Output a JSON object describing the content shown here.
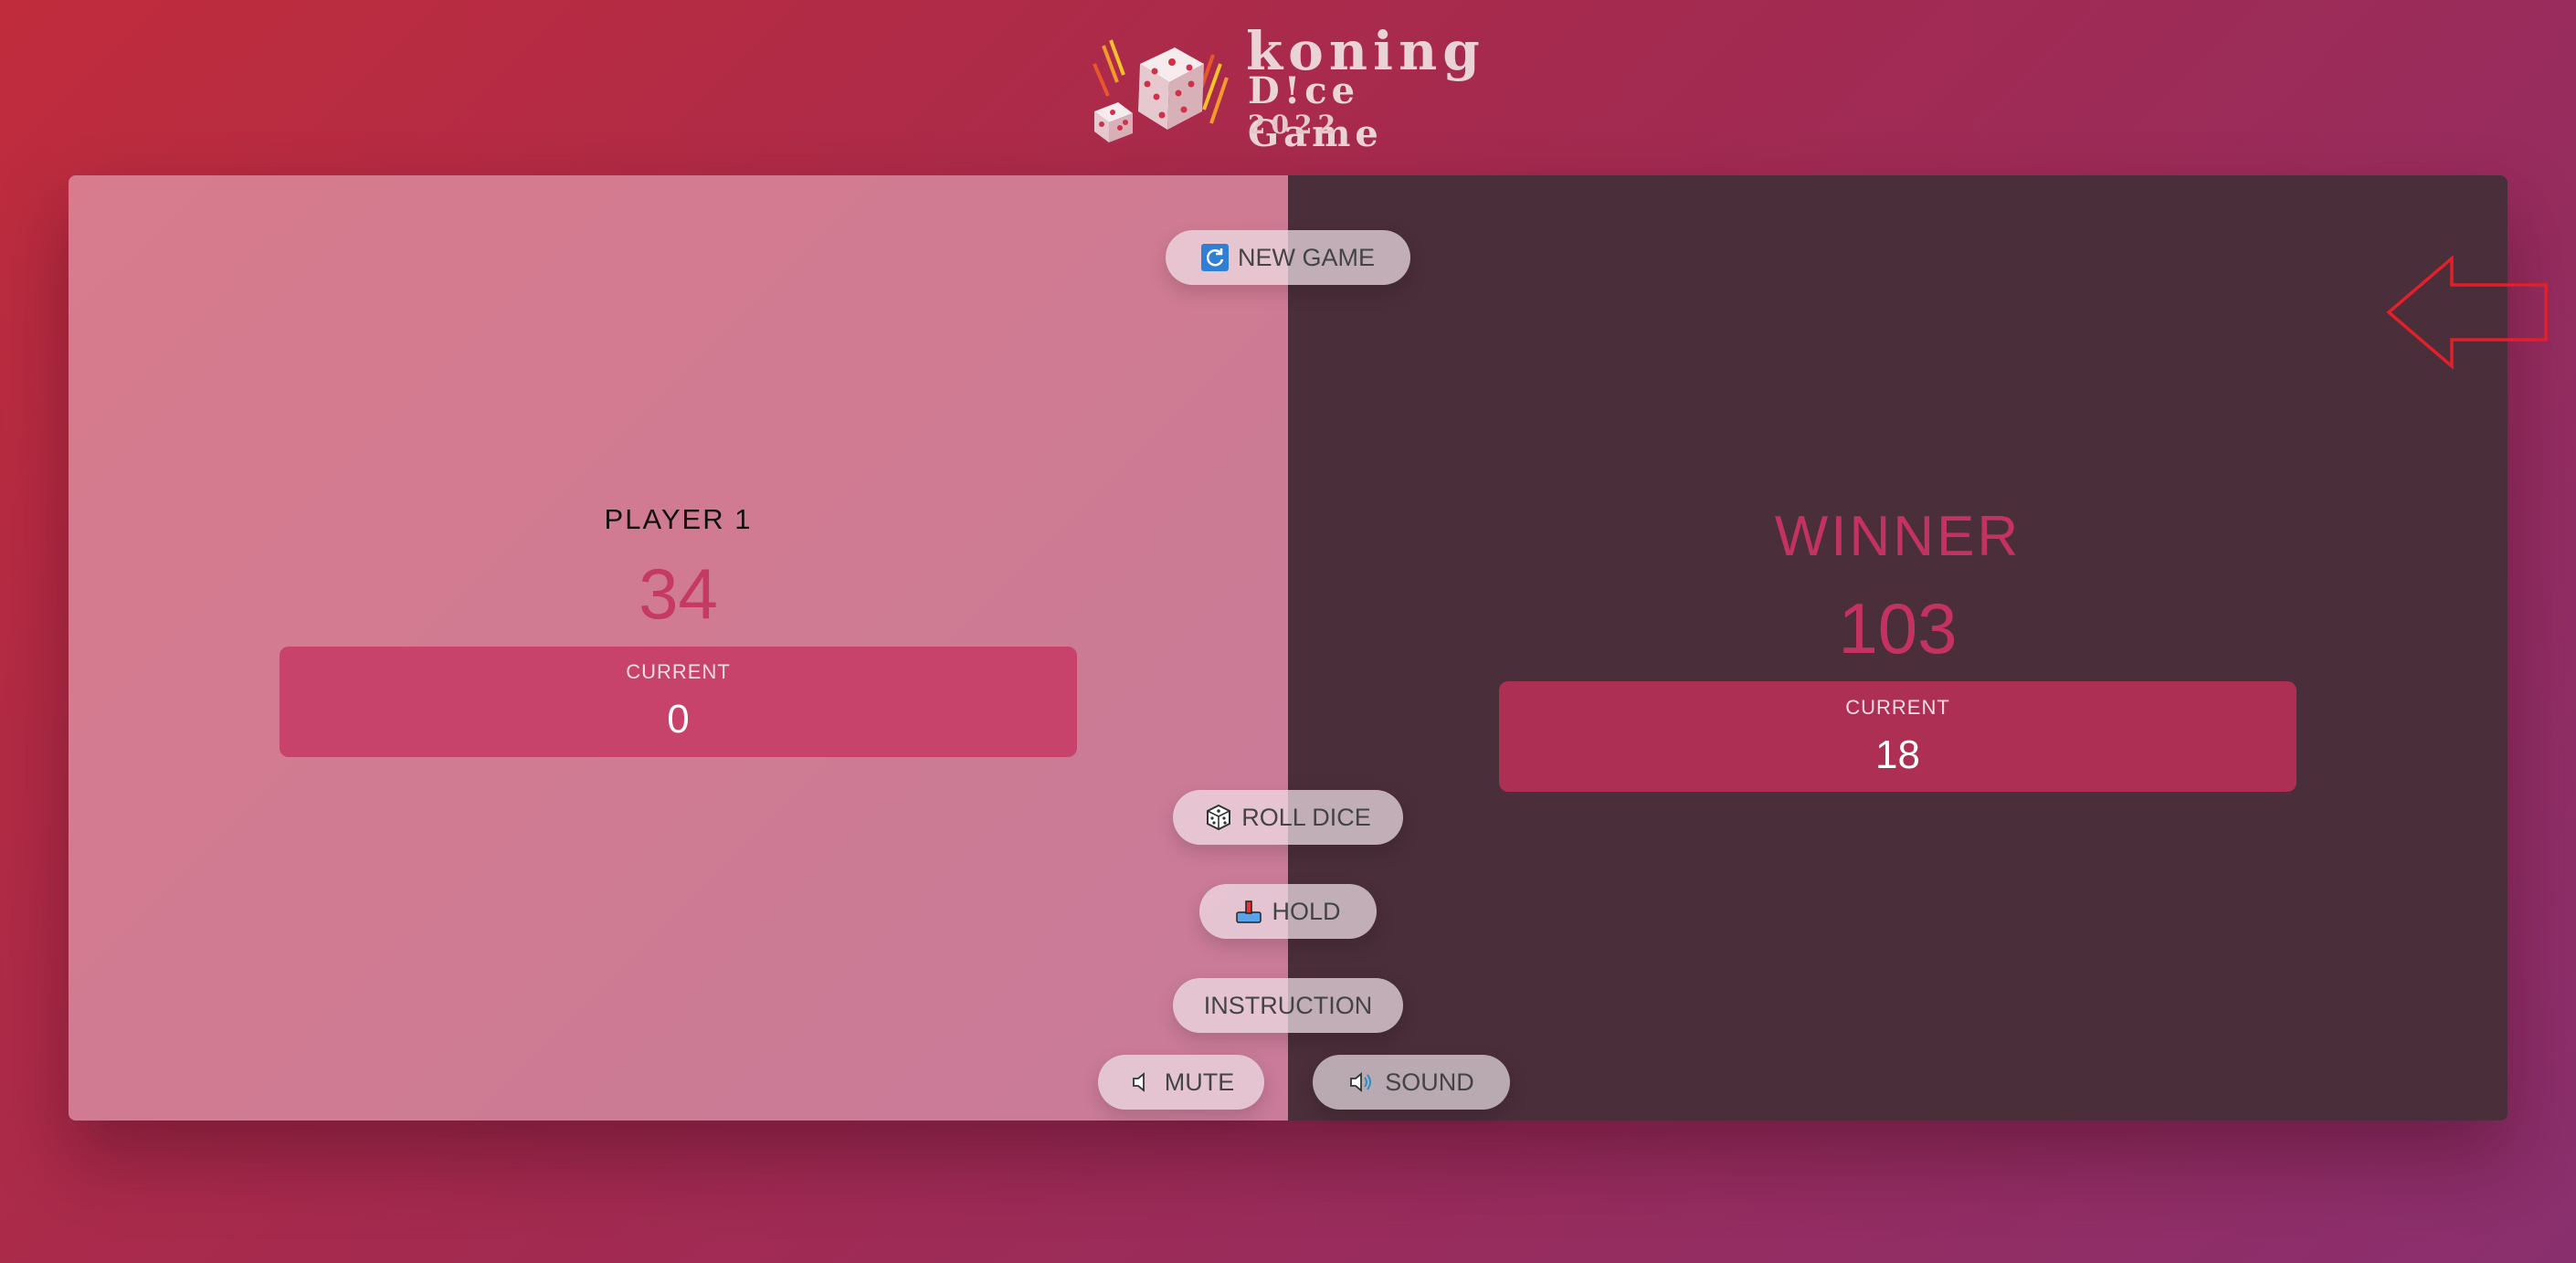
{
  "logo": {
    "line1": "koning",
    "line2": "D!ce Game",
    "line3": "2022"
  },
  "controls": {
    "new_game": "NEW GAME",
    "roll_dice": "ROLL DICE",
    "hold": "HOLD",
    "instruction": "INSTRUCTION",
    "mute": "MUTE",
    "sound": "SOUND"
  },
  "players": [
    {
      "name": "PLAYER 1",
      "score": "34",
      "current_label": "CURRENT",
      "current": "0",
      "active": false
    },
    {
      "name": "WINNER",
      "score": "103",
      "current_label": "CURRENT",
      "current": "18",
      "active": true,
      "winner": true
    }
  ],
  "colors": {
    "accent": "#c43262",
    "winner_panel": "#4a2e3a",
    "arrow": "#e0202a"
  },
  "icons": {
    "new_game": "refresh-icon",
    "roll_dice": "dice-icon",
    "hold": "hold-icon",
    "mute": "speaker-mute-icon",
    "sound": "speaker-sound-icon",
    "winner_pointer": "left-arrow-icon"
  }
}
